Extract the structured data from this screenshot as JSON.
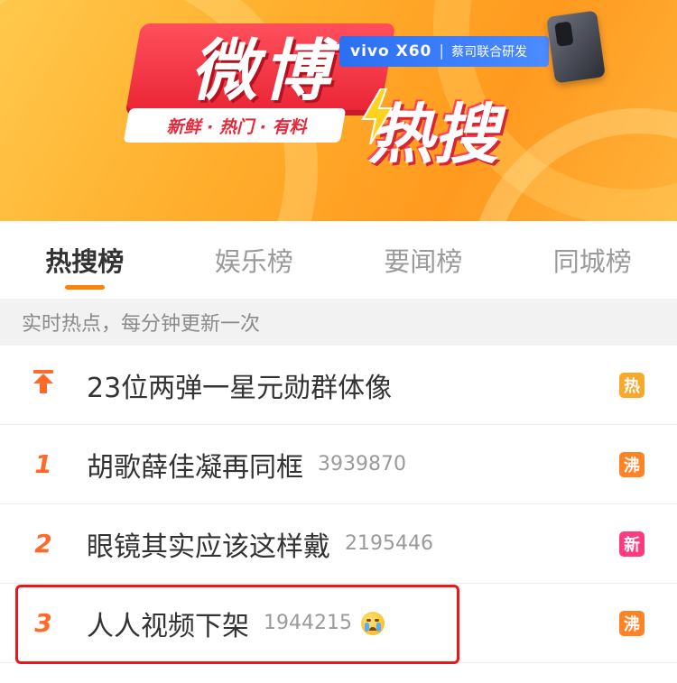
{
  "banner": {
    "logo_text": "微博",
    "slogan": "新鲜 · 热门 · 有料",
    "hot_search_text": "热搜",
    "sponsor_brand": "vivo X60",
    "sponsor_separator": "|",
    "sponsor_collab": "蔡司联合研发"
  },
  "tabs": [
    {
      "label": "热搜榜",
      "active": true
    },
    {
      "label": "娱乐榜",
      "active": false
    },
    {
      "label": "要闻榜",
      "active": false
    },
    {
      "label": "同城榜",
      "active": false
    }
  ],
  "info_text": "实时热点，每分钟更新一次",
  "list": [
    {
      "rank": "pin-icon",
      "title": "23位两弹一星元勋群体像",
      "count": "",
      "emoji": false,
      "badge": "热",
      "badge_color": "#f7a92b"
    },
    {
      "rank": "1",
      "title": "胡歌薛佳凝再同框",
      "count": "3939870",
      "emoji": false,
      "badge": "沸",
      "badge_color": "#ff8226"
    },
    {
      "rank": "2",
      "title": "眼镜其实应该这样戴",
      "count": "2195446",
      "emoji": false,
      "badge": "新",
      "badge_color": "#ff3b7f"
    },
    {
      "rank": "3",
      "title": "人人视频下架",
      "count": "1944215",
      "emoji": true,
      "badge": "沸",
      "badge_color": "#ff8226"
    }
  ],
  "colors": {
    "accent": "#ff8200",
    "rank": "#ff6a2c",
    "highlight_box": "#e81818"
  }
}
